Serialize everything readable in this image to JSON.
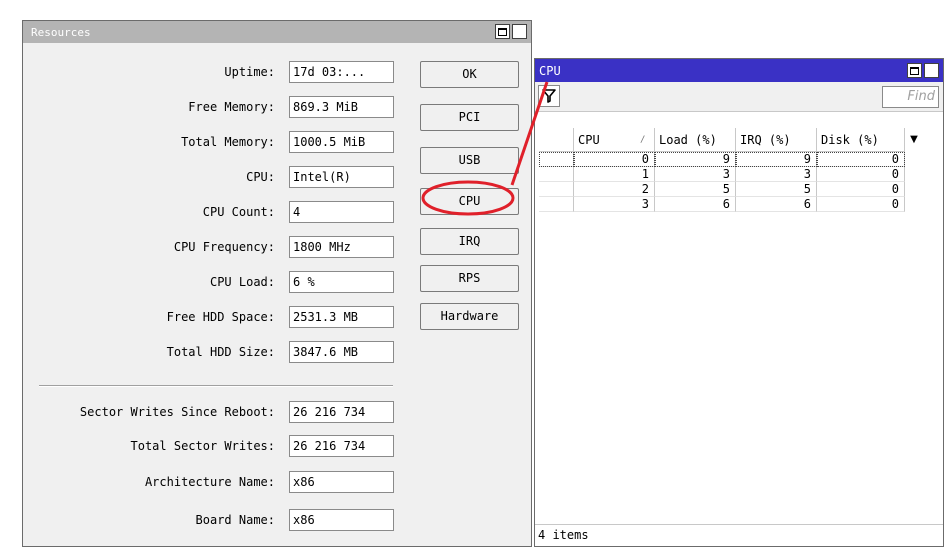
{
  "resources_window": {
    "title": "Resources",
    "fields": [
      {
        "label": "Uptime:",
        "value": "17d 03:..."
      },
      {
        "label": "Free Memory:",
        "value": "869.3 MiB"
      },
      {
        "label": "Total Memory:",
        "value": "1000.5 MiB"
      },
      {
        "label": "CPU:",
        "value": "Intel(R)"
      },
      {
        "label": "CPU Count:",
        "value": "4"
      },
      {
        "label": "CPU Frequency:",
        "value": "1800 MHz"
      },
      {
        "label": "CPU Load:",
        "value": "6 %"
      },
      {
        "label": "Free HDD Space:",
        "value": "2531.3 MB"
      },
      {
        "label": "Total HDD Size:",
        "value": "3847.6 MB"
      },
      {
        "label": "Sector Writes Since Reboot:",
        "value": "26 216 734"
      },
      {
        "label": "Total Sector Writes:",
        "value": "26 216 734"
      },
      {
        "label": "Architecture Name:",
        "value": "x86"
      },
      {
        "label": "Board Name:",
        "value": "x86"
      }
    ],
    "buttons": {
      "ok": "OK",
      "pci": "PCI",
      "usb": "USB",
      "cpu": "CPU",
      "irq": "IRQ",
      "rps": "RPS",
      "hardware": "Hardware"
    }
  },
  "cpu_window": {
    "title": "CPU",
    "find_placeholder": "Find",
    "columns": [
      "CPU",
      "Load (%)",
      "IRQ (%)",
      "Disk (%)"
    ],
    "sort_indicator": "/",
    "rows": [
      {
        "cpu": "0",
        "load": "9",
        "irq": "9",
        "disk": "0"
      },
      {
        "cpu": "1",
        "load": "3",
        "irq": "3",
        "disk": "0"
      },
      {
        "cpu": "2",
        "load": "5",
        "irq": "5",
        "disk": "0"
      },
      {
        "cpu": "3",
        "load": "6",
        "irq": "6",
        "disk": "0"
      }
    ],
    "status": "4 items"
  },
  "colors": {
    "active_title": "#3a31c5",
    "inactive_title": "#b4b4b4",
    "annotation": "#e0202a"
  },
  "icons": {
    "filter": "filter-icon",
    "maximize": "maximize-icon",
    "close": "close-icon",
    "column_menu": "column-menu-icon"
  }
}
